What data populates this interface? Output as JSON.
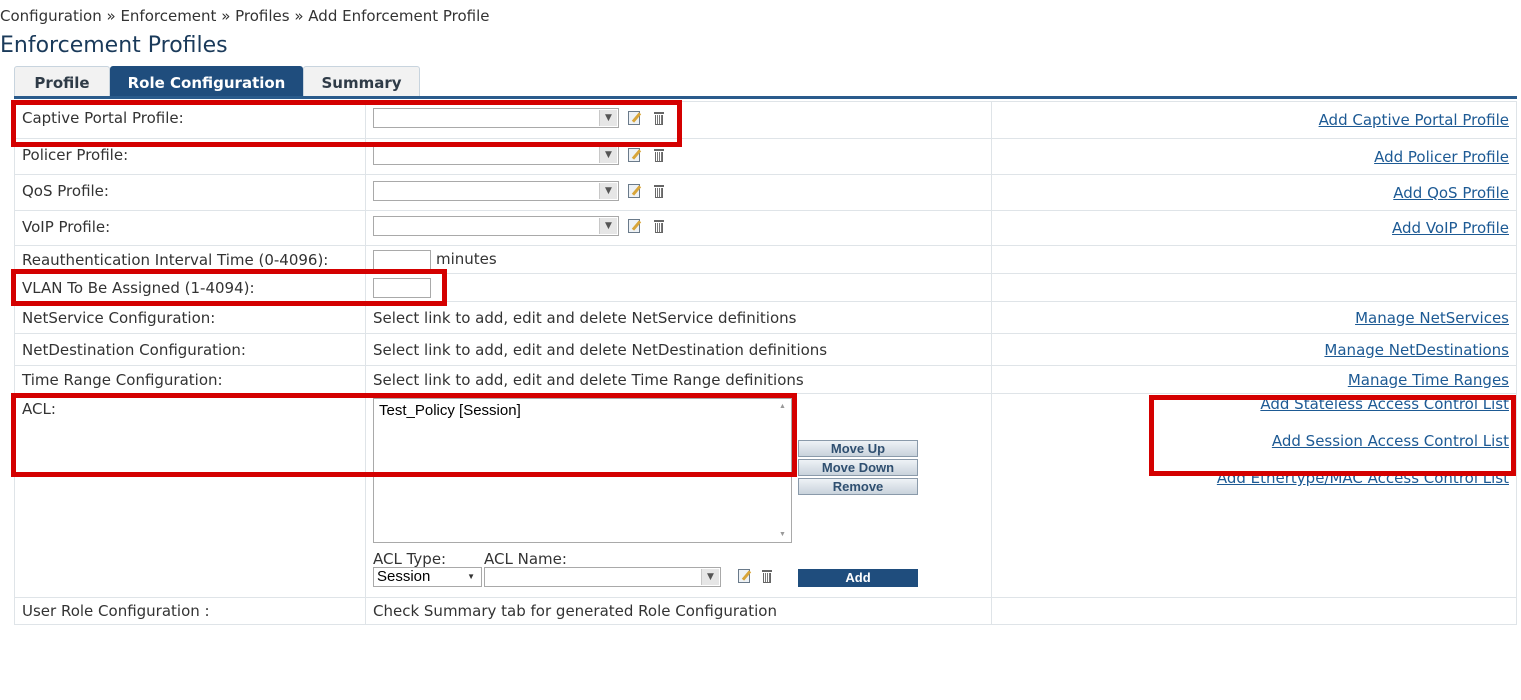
{
  "breadcrumb": "Configuration » Enforcement » Profiles » Add Enforcement Profile",
  "page_title": "Enforcement Profiles",
  "tabs": [
    {
      "label": "Profile"
    },
    {
      "label": "Role Configuration",
      "active": true
    },
    {
      "label": "Summary"
    }
  ],
  "rows": {
    "captive": {
      "label": "Captive Portal Profile:",
      "link": "Add Captive Portal Profile",
      "selected": ""
    },
    "policer": {
      "label": "Policer Profile:",
      "link": "Add Policer Profile",
      "selected": ""
    },
    "qos": {
      "label": "QoS Profile:",
      "link": "Add QoS Profile",
      "selected": ""
    },
    "voip": {
      "label": "VoIP Profile:",
      "link": "Add VoIP Profile",
      "selected": ""
    },
    "reauth": {
      "label": "Reauthentication Interval Time (0-4096):",
      "value": "",
      "units": "minutes"
    },
    "vlan": {
      "label": "VLAN To Be Assigned (1-4094):",
      "value": ""
    },
    "netservice": {
      "label": "NetService Configuration:",
      "text": "Select link to add, edit and delete NetService definitions",
      "link": "Manage NetServices"
    },
    "netdest": {
      "label": "NetDestination Configuration:",
      "text": "Select link to add, edit and delete NetDestination definitions",
      "link": "Manage NetDestinations"
    },
    "timerange": {
      "label": "Time Range Configuration:",
      "text": "Select link to add, edit and delete Time Range definitions",
      "link": "Manage Time Ranges"
    },
    "acl": {
      "label": "ACL:",
      "items": [
        "Test_Policy [Session]"
      ],
      "move_up": "Move Up",
      "move_down": "Move Down",
      "remove": "Remove",
      "acl_type_label": "ACL Type:",
      "acl_name_label": "ACL Name:",
      "acl_type_value": "Session",
      "acl_name_value": "",
      "add": "Add",
      "links": [
        "Add Stateless Access Control List",
        "Add Session Access Control List",
        "Add Ethertype/MAC Access Control List"
      ]
    },
    "userrole": {
      "label": "User Role Configuration :",
      "text": "Check Summary tab for generated Role Configuration"
    }
  },
  "icons": {
    "edit": "edit-icon",
    "delete": "trash-icon",
    "dropdown": "chevron-down-icon"
  },
  "colors": {
    "accent": "#1f4d7d",
    "link": "#1d5a94",
    "highlight": "#d40000"
  }
}
